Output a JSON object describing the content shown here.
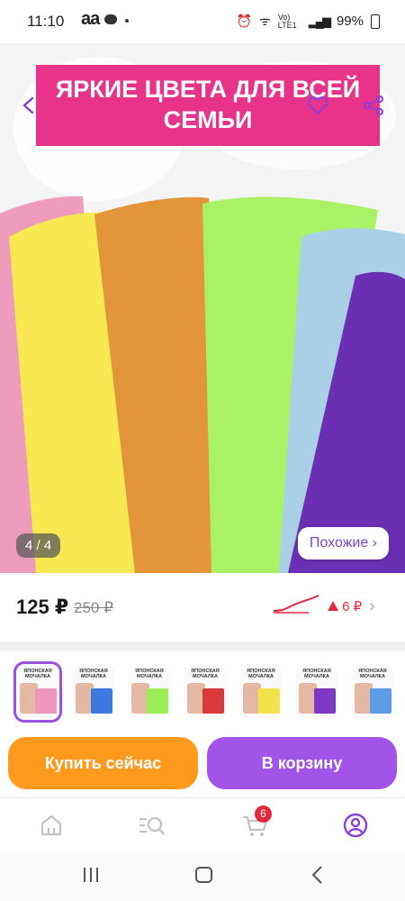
{
  "status_bar": {
    "time": "11:10",
    "app_glyphs": "aa",
    "signal_text": "Vo) LTE1",
    "battery": "99%"
  },
  "hero": {
    "banner_line1": "ЯРКИЕ ЦВЕТА ДЛЯ ВСЕЙ",
    "banner_line2": "СЕМЬИ",
    "counter": "4 / 4",
    "similar": "Похожие ›",
    "cloth_colors": [
      "#ee9cbc",
      "#f8e851",
      "#e3953a",
      "#a9f265",
      "#a9d0e6",
      "#6a2fb2"
    ]
  },
  "price": {
    "current": "125 ₽",
    "old": "250 ₽",
    "delta": "6 ₽",
    "delta_color": "#e32a3b"
  },
  "thumbnails": [
    {
      "title": "ЯПОНСКАЯ МОЧАЛКА",
      "pack_color": "#ef96bd"
    },
    {
      "title": "ЯПОНСКАЯ МОЧАЛКА",
      "pack_color": "#3c79df"
    },
    {
      "title": "ЯПОНСКАЯ МОЧАЛКА",
      "pack_color": "#9bee55"
    },
    {
      "title": "ЯПОНСКАЯ МОЧАЛКА",
      "pack_color": "#d83a3a"
    },
    {
      "title": "ЯПОНСКАЯ МОЧАЛКА",
      "pack_color": "#f2e34c"
    },
    {
      "title": "ЯПОНСКАЯ МОЧАЛКА",
      "pack_color": "#7a3ac4"
    },
    {
      "title": "ЯПОНСКАЯ МОЧАЛКА",
      "pack_color": "#5e9ce6"
    }
  ],
  "actions": {
    "buy_now": "Купить сейчас",
    "add_to_cart": "В корзину",
    "buy_color": "#ff9a1f",
    "cart_color": "#a254e8"
  },
  "bottom_nav": {
    "items": [
      "home-icon",
      "catalog-search-icon",
      "cart-icon",
      "profile-icon"
    ],
    "cart_badge": "6",
    "accent": "#8b3fd6"
  }
}
